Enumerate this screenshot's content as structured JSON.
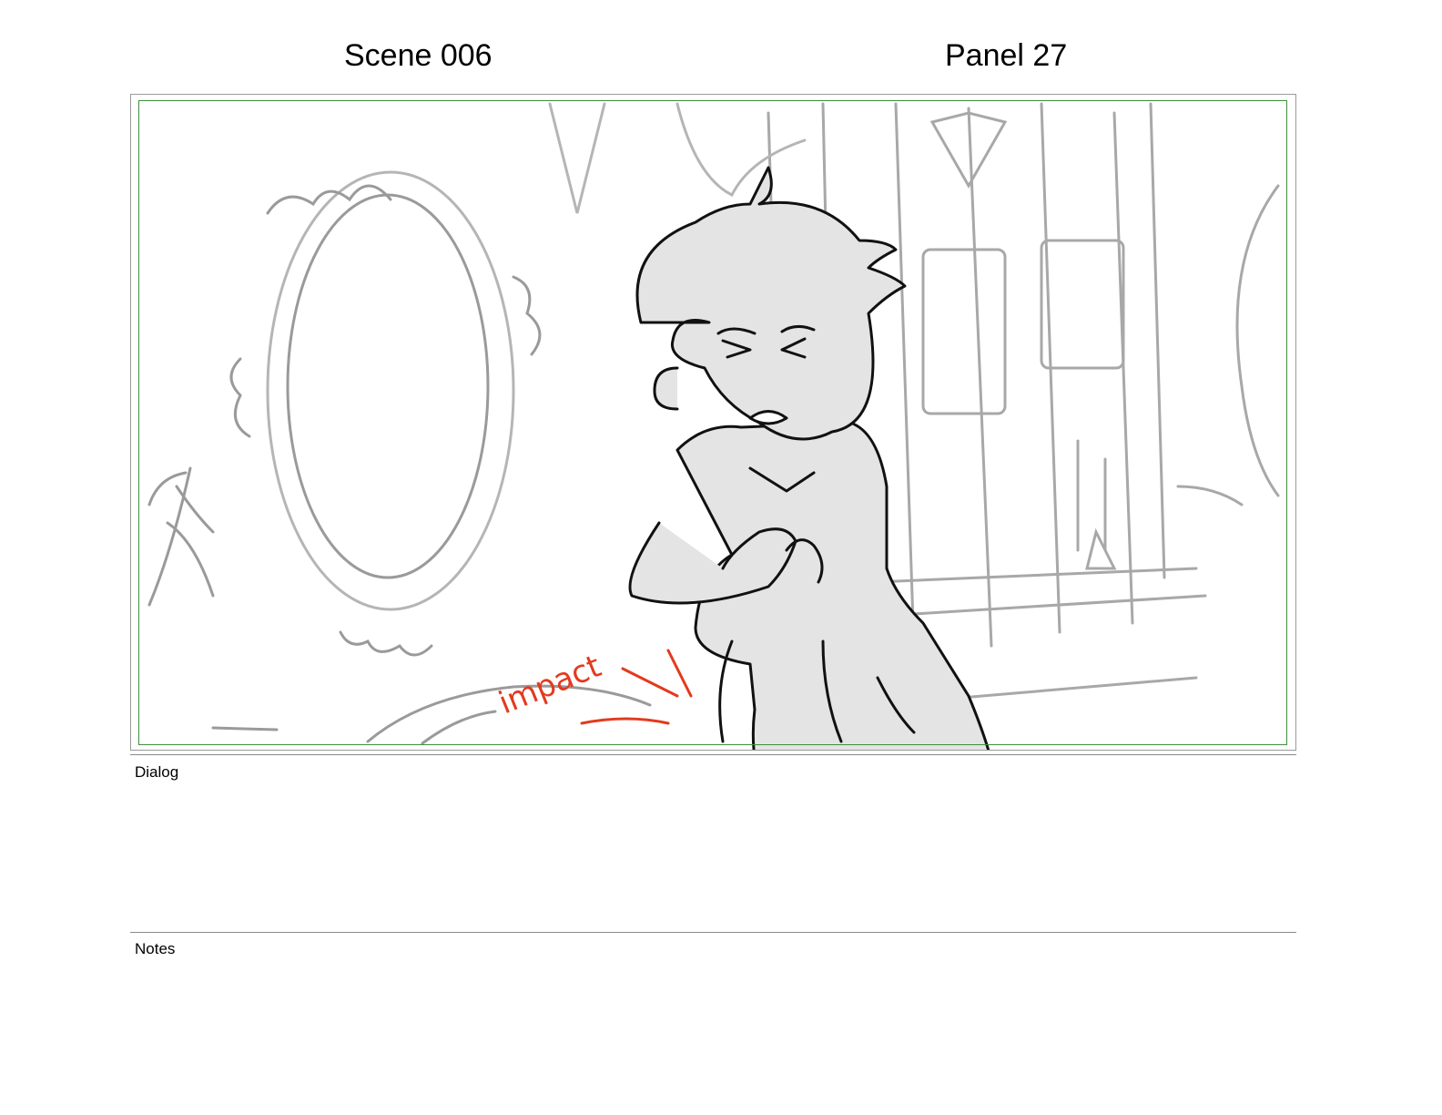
{
  "header": {
    "scene": "Scene 006",
    "panel": "Panel 27"
  },
  "panel_art": {
    "annotation": "impact",
    "annotation_color": "#e33a1e",
    "safe_frame_color": "#3e8f3e"
  },
  "sections": {
    "dialog_label": "Dialog",
    "notes_label": "Notes"
  }
}
